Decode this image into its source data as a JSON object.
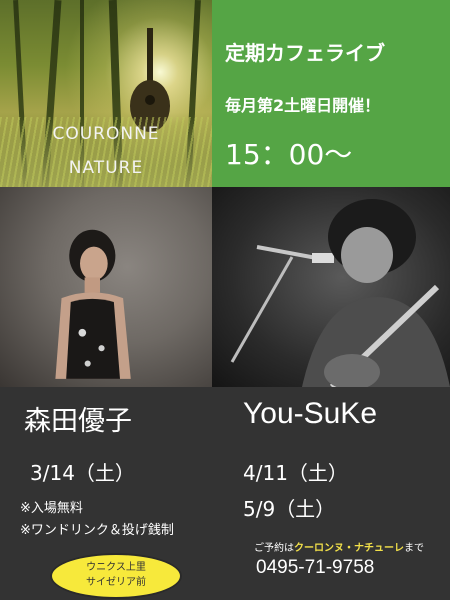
{
  "brand": {
    "line1": "COURONNE",
    "line2": "NATURE"
  },
  "header": {
    "title": "定期カフェライブ",
    "schedule": "毎月第2土曜日開催！",
    "time": "15：00～"
  },
  "performers": [
    {
      "name": "森田優子",
      "dates": [
        "3/14（土）"
      ]
    },
    {
      "name": "You-SuKe",
      "dates": [
        "4/11（土）",
        "5/9（土）"
      ]
    }
  ],
  "notes": [
    "※入場無料",
    "※ワンドリンク＆投げ銭制"
  ],
  "location_badge": {
    "line1": "ウニクス上里",
    "line2": "サイゼリア前"
  },
  "reservation": {
    "prefix": "ご予約は",
    "highlight": "クーロンヌ・ナチューレ",
    "suffix": "まで"
  },
  "phone": "0495-71-9758",
  "colors": {
    "green_panel": "#55a545",
    "dark_bg": "#333333",
    "badge": "#f7e93b",
    "highlight": "#f2e04a"
  }
}
